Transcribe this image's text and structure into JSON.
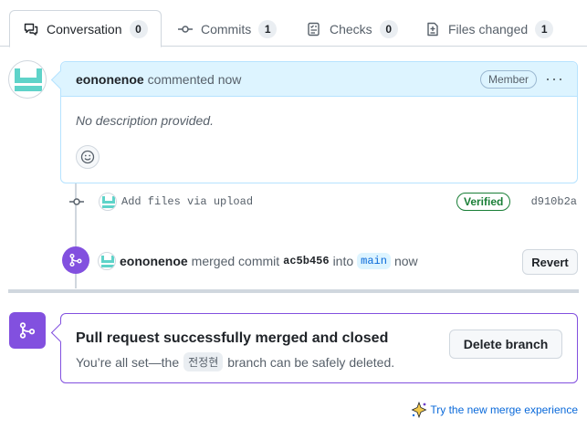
{
  "tabs": [
    {
      "label": "Conversation",
      "count": "0",
      "icon": "conversation-icon"
    },
    {
      "label": "Commits",
      "count": "1",
      "icon": "commit-icon"
    },
    {
      "label": "Checks",
      "count": "0",
      "icon": "checks-icon"
    },
    {
      "label": "Files changed",
      "count": "1",
      "icon": "file-diff-icon"
    }
  ],
  "comment": {
    "author": "eononenoe",
    "action": "commented now",
    "role_badge": "Member",
    "more_menu": "···",
    "body": "No description provided."
  },
  "commit": {
    "message": "Add files via upload",
    "verified": "Verified",
    "sha": "d910b2a"
  },
  "merge_event": {
    "author": "eononenoe",
    "text_before": "merged commit",
    "sha": "ac5b456",
    "text_into": "into",
    "branch": "main",
    "time": "now",
    "revert_label": "Revert"
  },
  "merged_box": {
    "title": "Pull request successfully merged and closed",
    "sub_before": "You’re all set—the",
    "branch": "전정현",
    "sub_after": "branch can be safely deleted.",
    "delete_label": "Delete branch"
  },
  "footer": {
    "try_link": "Try the new merge experience"
  },
  "colors": {
    "accent_purple": "#8250df",
    "link_blue": "#0969da",
    "verified_green": "#1a7f37",
    "comment_header_bg": "#ddf4ff",
    "avatar_teal": "#5fd3c9"
  }
}
